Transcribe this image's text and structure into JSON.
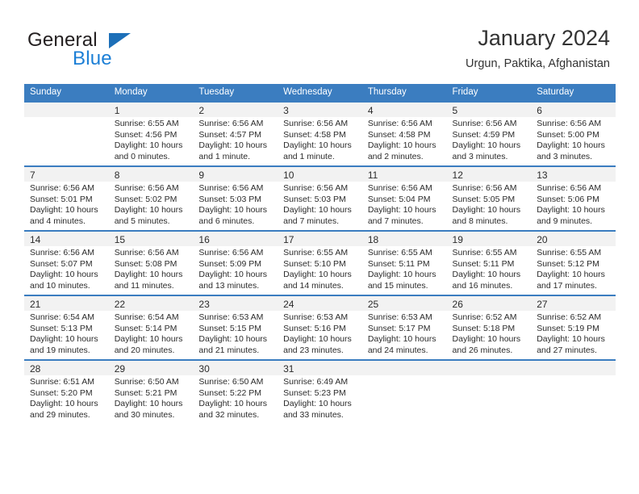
{
  "brand": {
    "name_part1": "General",
    "name_part2": "Blue",
    "accent_color": "#1c7fd6",
    "header_color": "#3b7dc0"
  },
  "header": {
    "title": "January 2024",
    "subtitle": "Urgun, Paktika, Afghanistan"
  },
  "weekdays": [
    "Sunday",
    "Monday",
    "Tuesday",
    "Wednesday",
    "Thursday",
    "Friday",
    "Saturday"
  ],
  "weeks": [
    [
      {
        "day": "",
        "sunrise": "",
        "sunset": "",
        "daylight": ""
      },
      {
        "day": "1",
        "sunrise": "Sunrise: 6:55 AM",
        "sunset": "Sunset: 4:56 PM",
        "daylight": "Daylight: 10 hours and 0 minutes."
      },
      {
        "day": "2",
        "sunrise": "Sunrise: 6:56 AM",
        "sunset": "Sunset: 4:57 PM",
        "daylight": "Daylight: 10 hours and 1 minute."
      },
      {
        "day": "3",
        "sunrise": "Sunrise: 6:56 AM",
        "sunset": "Sunset: 4:58 PM",
        "daylight": "Daylight: 10 hours and 1 minute."
      },
      {
        "day": "4",
        "sunrise": "Sunrise: 6:56 AM",
        "sunset": "Sunset: 4:58 PM",
        "daylight": "Daylight: 10 hours and 2 minutes."
      },
      {
        "day": "5",
        "sunrise": "Sunrise: 6:56 AM",
        "sunset": "Sunset: 4:59 PM",
        "daylight": "Daylight: 10 hours and 3 minutes."
      },
      {
        "day": "6",
        "sunrise": "Sunrise: 6:56 AM",
        "sunset": "Sunset: 5:00 PM",
        "daylight": "Daylight: 10 hours and 3 minutes."
      }
    ],
    [
      {
        "day": "7",
        "sunrise": "Sunrise: 6:56 AM",
        "sunset": "Sunset: 5:01 PM",
        "daylight": "Daylight: 10 hours and 4 minutes."
      },
      {
        "day": "8",
        "sunrise": "Sunrise: 6:56 AM",
        "sunset": "Sunset: 5:02 PM",
        "daylight": "Daylight: 10 hours and 5 minutes."
      },
      {
        "day": "9",
        "sunrise": "Sunrise: 6:56 AM",
        "sunset": "Sunset: 5:03 PM",
        "daylight": "Daylight: 10 hours and 6 minutes."
      },
      {
        "day": "10",
        "sunrise": "Sunrise: 6:56 AM",
        "sunset": "Sunset: 5:03 PM",
        "daylight": "Daylight: 10 hours and 7 minutes."
      },
      {
        "day": "11",
        "sunrise": "Sunrise: 6:56 AM",
        "sunset": "Sunset: 5:04 PM",
        "daylight": "Daylight: 10 hours and 7 minutes."
      },
      {
        "day": "12",
        "sunrise": "Sunrise: 6:56 AM",
        "sunset": "Sunset: 5:05 PM",
        "daylight": "Daylight: 10 hours and 8 minutes."
      },
      {
        "day": "13",
        "sunrise": "Sunrise: 6:56 AM",
        "sunset": "Sunset: 5:06 PM",
        "daylight": "Daylight: 10 hours and 9 minutes."
      }
    ],
    [
      {
        "day": "14",
        "sunrise": "Sunrise: 6:56 AM",
        "sunset": "Sunset: 5:07 PM",
        "daylight": "Daylight: 10 hours and 10 minutes."
      },
      {
        "day": "15",
        "sunrise": "Sunrise: 6:56 AM",
        "sunset": "Sunset: 5:08 PM",
        "daylight": "Daylight: 10 hours and 11 minutes."
      },
      {
        "day": "16",
        "sunrise": "Sunrise: 6:56 AM",
        "sunset": "Sunset: 5:09 PM",
        "daylight": "Daylight: 10 hours and 13 minutes."
      },
      {
        "day": "17",
        "sunrise": "Sunrise: 6:55 AM",
        "sunset": "Sunset: 5:10 PM",
        "daylight": "Daylight: 10 hours and 14 minutes."
      },
      {
        "day": "18",
        "sunrise": "Sunrise: 6:55 AM",
        "sunset": "Sunset: 5:11 PM",
        "daylight": "Daylight: 10 hours and 15 minutes."
      },
      {
        "day": "19",
        "sunrise": "Sunrise: 6:55 AM",
        "sunset": "Sunset: 5:11 PM",
        "daylight": "Daylight: 10 hours and 16 minutes."
      },
      {
        "day": "20",
        "sunrise": "Sunrise: 6:55 AM",
        "sunset": "Sunset: 5:12 PM",
        "daylight": "Daylight: 10 hours and 17 minutes."
      }
    ],
    [
      {
        "day": "21",
        "sunrise": "Sunrise: 6:54 AM",
        "sunset": "Sunset: 5:13 PM",
        "daylight": "Daylight: 10 hours and 19 minutes."
      },
      {
        "day": "22",
        "sunrise": "Sunrise: 6:54 AM",
        "sunset": "Sunset: 5:14 PM",
        "daylight": "Daylight: 10 hours and 20 minutes."
      },
      {
        "day": "23",
        "sunrise": "Sunrise: 6:53 AM",
        "sunset": "Sunset: 5:15 PM",
        "daylight": "Daylight: 10 hours and 21 minutes."
      },
      {
        "day": "24",
        "sunrise": "Sunrise: 6:53 AM",
        "sunset": "Sunset: 5:16 PM",
        "daylight": "Daylight: 10 hours and 23 minutes."
      },
      {
        "day": "25",
        "sunrise": "Sunrise: 6:53 AM",
        "sunset": "Sunset: 5:17 PM",
        "daylight": "Daylight: 10 hours and 24 minutes."
      },
      {
        "day": "26",
        "sunrise": "Sunrise: 6:52 AM",
        "sunset": "Sunset: 5:18 PM",
        "daylight": "Daylight: 10 hours and 26 minutes."
      },
      {
        "day": "27",
        "sunrise": "Sunrise: 6:52 AM",
        "sunset": "Sunset: 5:19 PM",
        "daylight": "Daylight: 10 hours and 27 minutes."
      }
    ],
    [
      {
        "day": "28",
        "sunrise": "Sunrise: 6:51 AM",
        "sunset": "Sunset: 5:20 PM",
        "daylight": "Daylight: 10 hours and 29 minutes."
      },
      {
        "day": "29",
        "sunrise": "Sunrise: 6:50 AM",
        "sunset": "Sunset: 5:21 PM",
        "daylight": "Daylight: 10 hours and 30 minutes."
      },
      {
        "day": "30",
        "sunrise": "Sunrise: 6:50 AM",
        "sunset": "Sunset: 5:22 PM",
        "daylight": "Daylight: 10 hours and 32 minutes."
      },
      {
        "day": "31",
        "sunrise": "Sunrise: 6:49 AM",
        "sunset": "Sunset: 5:23 PM",
        "daylight": "Daylight: 10 hours and 33 minutes."
      },
      {
        "day": "",
        "sunrise": "",
        "sunset": "",
        "daylight": ""
      },
      {
        "day": "",
        "sunrise": "",
        "sunset": "",
        "daylight": ""
      },
      {
        "day": "",
        "sunrise": "",
        "sunset": "",
        "daylight": ""
      }
    ]
  ]
}
